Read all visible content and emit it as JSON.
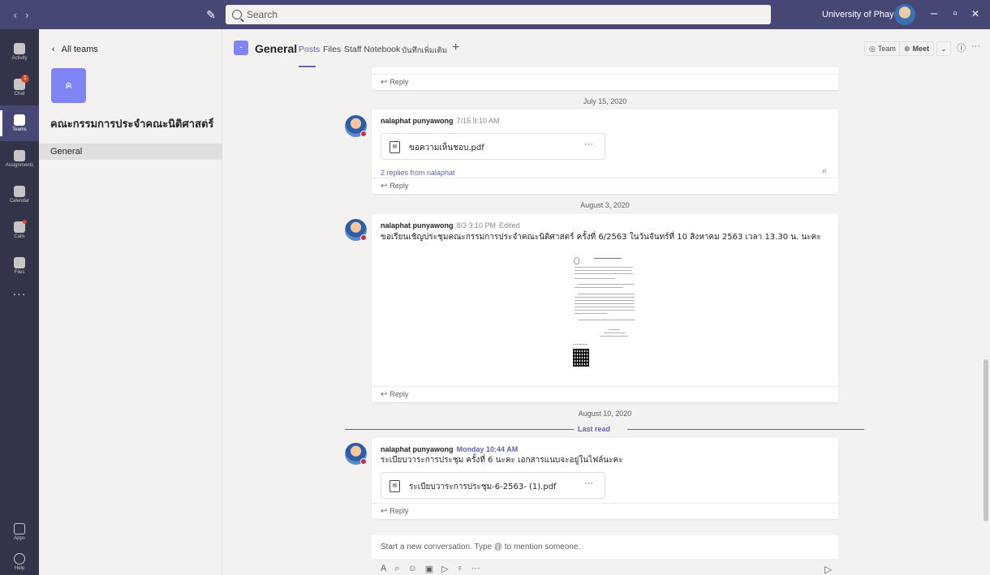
{
  "titlebar": {
    "search_placeholder": "Search",
    "org_name": "University of Phayao",
    "org_chevron": "⌄",
    "nav_back": "‹",
    "nav_forward": "›",
    "minimize": "–",
    "maximize": "▫",
    "close": "✕"
  },
  "appbar": {
    "items": [
      {
        "label": "Activity",
        "icon": "bell-icon"
      },
      {
        "label": "Chat",
        "icon": "chat-icon",
        "badge": "1"
      },
      {
        "label": "Teams",
        "icon": "teams-icon"
      },
      {
        "label": "Assignments",
        "icon": "assignments-icon"
      },
      {
        "label": "Calendar",
        "icon": "calendar-icon"
      },
      {
        "label": "Calls",
        "icon": "phone-icon"
      },
      {
        "label": "Files",
        "icon": "files-icon"
      }
    ],
    "more": "···",
    "apps_label": "Apps",
    "help_label": "Help"
  },
  "teams_panel": {
    "back_label": "All teams",
    "team_initial": "ค",
    "team_name": "คณะกรรมการประจำคณะนิติศาสตร์",
    "team_more": "···",
    "channels": [
      "General"
    ]
  },
  "channel_header": {
    "title": "General",
    "tabs": [
      "Posts",
      "Files",
      "Staff Notebook",
      "บันทึกเพิ่มเติม"
    ],
    "add": "+",
    "team_btn": "Team",
    "meet_btn": "Meet",
    "info": "ⓘ",
    "more": "···"
  },
  "feed": {
    "reply_label": "Reply",
    "dates": [
      "July 15, 2020",
      "August 3, 2020",
      "August 10, 2020"
    ],
    "last_read": "Last read",
    "messages": [
      {
        "author": "nalaphat punyawong",
        "time": "7/15 9:10 AM",
        "file": "ขอความเห็นชอบ.pdf",
        "replies": "2 replies from nalaphat"
      },
      {
        "author": "nalaphat punyawong",
        "time": "8/3 3:10 PM",
        "edited": "Edited",
        "text": "ขอเรียนเชิญประชุมคณะกรรมการประจำคณะนิติศาสตร์ ครั้งที่ 6/2563 ในวันจันทร์ที่ 10 สิงหาคม 2563 เวลา 13.30 น. นะคะ"
      },
      {
        "author": "nalaphat punyawong",
        "time": "Monday 10:44 AM",
        "text": "ระเบียบวาระการประชุม ครั้งที่ 6 นะคะ เอกสารแนบจะอยู่ในไฟล์นะคะ",
        "file": "ระเบียบวาระการประชุม-6-2563- (1).pdf"
      }
    ],
    "file_more": "···",
    "composer_placeholder": "Start a new conversation. Type @ to mention someone."
  }
}
